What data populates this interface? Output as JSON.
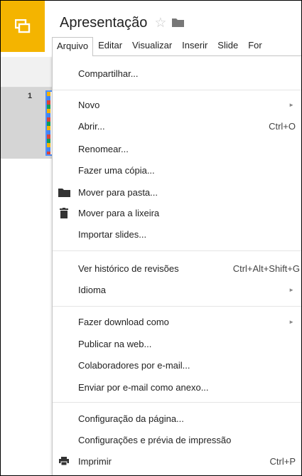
{
  "document": {
    "title": "Apresentação"
  },
  "colors": {
    "logo": "#f4b400",
    "selection": "#4d90fe"
  },
  "menubar": [
    "Arquivo",
    "Editar",
    "Visualizar",
    "Inserir",
    "Slide",
    "For"
  ],
  "filmstrip": {
    "slide_number": "1"
  },
  "file_menu": {
    "share": "Compartilhar...",
    "new": "Novo",
    "open": "Abrir...",
    "open_shortcut": "Ctrl+O",
    "rename": "Renomear...",
    "make_copy": "Fazer uma cópia...",
    "move_to_folder": "Mover para pasta...",
    "move_to_trash": "Mover para a lixeira",
    "import_slides": "Importar slides...",
    "revision_history": "Ver histórico de revisões",
    "revision_history_shortcut": "Ctrl+Alt+Shift+G",
    "language": "Idioma",
    "download_as": "Fazer download como",
    "publish_web": "Publicar na web...",
    "email_collaborators": "Colaboradores por e-mail...",
    "email_attachment": "Enviar por e-mail como anexo...",
    "page_setup": "Configuração da página...",
    "print_settings": "Configurações e prévia de impressão",
    "print": "Imprimir",
    "print_shortcut": "Ctrl+P"
  }
}
